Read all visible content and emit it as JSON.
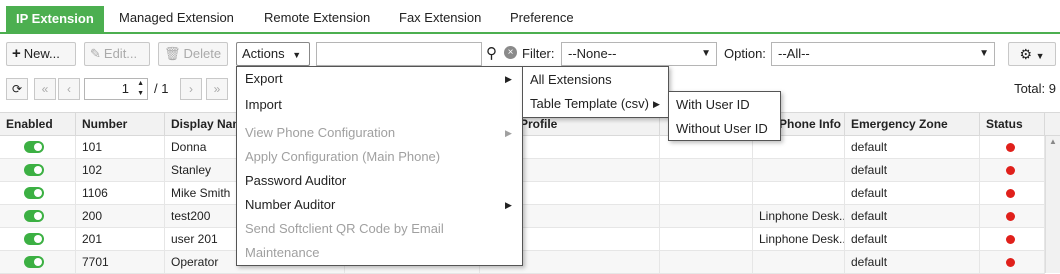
{
  "tabs": [
    "IP Extension",
    "Managed Extension",
    "Remote Extension",
    "Fax Extension",
    "Preference"
  ],
  "toolbar": {
    "new_label": "New...",
    "edit_label": "Edit...",
    "delete_label": "Delete",
    "actions_label": "Actions",
    "search_value": "",
    "filter_label": "Filter:",
    "filter_value": "--None--",
    "option_label": "Option:",
    "option_value": "--All--"
  },
  "pager": {
    "page": "1",
    "separator": "/ 1",
    "total": "Total: 9"
  },
  "columns": [
    "Enabled",
    "Number",
    "Display Name",
    "",
    "Profile",
    "",
    "Phone Info",
    "Emergency Zone",
    "Status"
  ],
  "rows": [
    {
      "number": "101",
      "name": "Donna",
      "phone_info": "",
      "zone": "default"
    },
    {
      "number": "102",
      "name": "Stanley",
      "phone_info": "",
      "zone": "default"
    },
    {
      "number": "1106",
      "name": "Mike Smith",
      "phone_info": "",
      "zone": "default"
    },
    {
      "number": "200",
      "name": "test200",
      "phone_info": "Linphone Desk...",
      "zone": "default"
    },
    {
      "number": "201",
      "name": "user 201",
      "phone_info": "Linphone Desk...",
      "zone": "default"
    },
    {
      "number": "7701",
      "name": "Operator",
      "phone_info": "",
      "zone": "default"
    }
  ],
  "actions_menu": [
    {
      "label": "Export",
      "enabled": true,
      "submenu": true
    },
    {
      "label": "Import",
      "enabled": true,
      "submenu": false
    },
    {
      "label": "View Phone Configuration",
      "enabled": false,
      "submenu": true
    },
    {
      "label": "Apply Configuration (Main Phone)",
      "enabled": false,
      "submenu": false
    },
    {
      "label": "Password Auditor",
      "enabled": true,
      "submenu": false
    },
    {
      "label": "Number Auditor",
      "enabled": true,
      "submenu": true
    },
    {
      "label": "Send Softclient QR Code by Email",
      "enabled": false,
      "submenu": false
    },
    {
      "label": "Maintenance",
      "enabled": false,
      "submenu": false
    }
  ],
  "export_menu": [
    "All Extensions",
    "Table Template (csv)"
  ],
  "template_menu": [
    "With User ID",
    "Without User ID"
  ],
  "colors": {
    "accent": "#4caf50",
    "toggle_on": "#3cb043",
    "status_dot": "#e0201b"
  }
}
